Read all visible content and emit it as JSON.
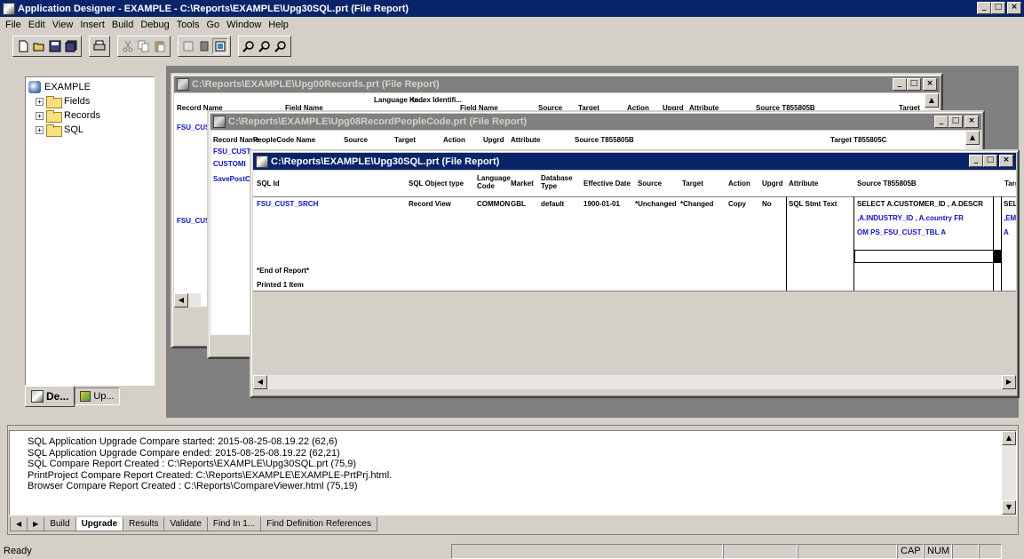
{
  "app": {
    "title": "Application Designer - EXAMPLE - C:\\Reports\\EXAMPLE\\Upg30SQL.prt (File Report)"
  },
  "menu": [
    "File",
    "Edit",
    "View",
    "Insert",
    "Build",
    "Debug",
    "Tools",
    "Go",
    "Window",
    "Help"
  ],
  "tree": {
    "root": "EXAMPLE",
    "items": [
      "Fields",
      "Records",
      "SQL"
    ],
    "tabs": [
      "De...",
      "Up..."
    ]
  },
  "win_records": {
    "title": "C:\\Reports\\EXAMPLE\\Upg00Records.prt (File Report)",
    "headers": [
      "Record Name",
      "Field Name",
      "Language Ke...",
      "Index Identifi...",
      "Field Name",
      "Source",
      "Target",
      "Action",
      "Upgrd",
      "Attribute",
      "Source T855805B",
      "Target"
    ],
    "rows": [
      "FSU_CUST",
      "FSU_CUST"
    ]
  },
  "win_peoplecode": {
    "title": "C:\\Reports\\EXAMPLE\\Upg08RecordPeopleCode.prt (File Report)",
    "headers": [
      "Record Name",
      "PeopleCode Name",
      "Source",
      "Target",
      "Action",
      "Upgrd",
      "Attribute",
      "Source T855805B",
      "Target T855805C"
    ],
    "rows": [
      "FSU_CUST",
      "CUSTOMI",
      "SavePostC"
    ]
  },
  "win_sql": {
    "title": "C:\\Reports\\EXAMPLE\\Upg30SQL.prt (File Report)",
    "headers": {
      "sql_id": "SQL Id",
      "object_type": "SQL Object type",
      "language": "Language Code",
      "market": "Market",
      "dbtype": "Database Type",
      "effdate": "Effective Date",
      "source": "Source",
      "target": "Target",
      "action": "Action",
      "upgrd": "Upgrd",
      "attribute": "Attribute",
      "source_db": "Source T855805B",
      "target_db": "Targe"
    },
    "row": {
      "sql_id": "FSU_CUST_SRCH",
      "object_type": "Record View",
      "language": "COMMON",
      "market": "GBL",
      "dbtype": "default",
      "effdate": "1900-01-01",
      "source": "*Unchanged",
      "target": "*Changed",
      "action": "Copy",
      "upgrd": "No",
      "attribute": "SQL Stmt Text",
      "source_text_1": "SELECT A.CUSTOMER_ID , A.DESCR",
      "source_text_2": ",A.INDUSTRY_ID , A.country FR",
      "source_text_3": "OM PS_FSU_CUST_TBL A",
      "target_text_1": "SELEC",
      "target_text_2": ",EMF",
      "target_text_3": "A"
    },
    "footer_1": "*End of Report*",
    "footer_2": "Printed 1 Item"
  },
  "output": {
    "lines": [
      "SQL Application Upgrade Compare started:  2015-08-25-08.19.22 (62,6)",
      "SQL Application Upgrade Compare ended:  2015-08-25-08.19.22 (62,21)",
      "SQL Compare Report Created : C:\\Reports\\EXAMPLE\\Upg30SQL.prt (75,9)",
      "PrintProject Compare Report Created: C:\\Reports\\EXAMPLE\\EXAMPLE-PrtPrj.html.",
      "Browser Compare Report Created : C:\\Reports\\CompareViewer.html (75,19)"
    ],
    "tabs": [
      "Build",
      "Upgrade",
      "Results",
      "Validate",
      "Find In 1...",
      "Find Definition References"
    ],
    "active_tab": "Upgrade"
  },
  "status": {
    "text": "Ready",
    "cap": "CAP",
    "num": "NUM"
  }
}
